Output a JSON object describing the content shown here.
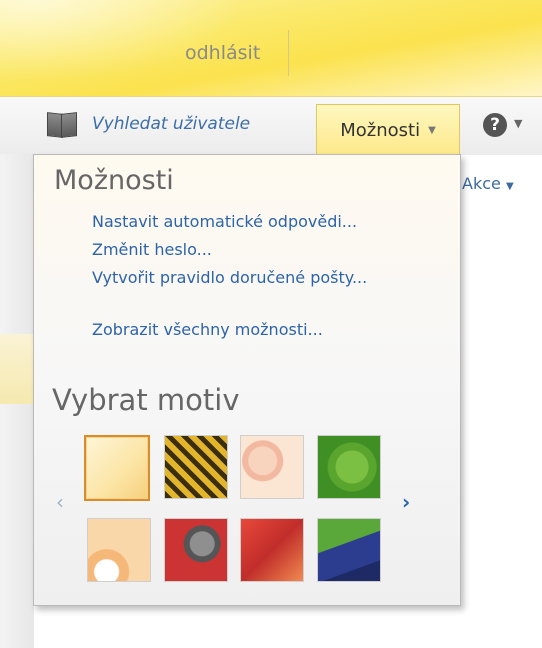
{
  "header": {
    "logout": "odhlásit"
  },
  "nav": {
    "find_user": "Vyhledat uživatele",
    "options_tab": "Možnosti",
    "help_symbol": "?",
    "actions": "Akce"
  },
  "panel": {
    "title": "Možnosti",
    "links": [
      "Nastavit automatické odpovědi...",
      "Změnit heslo...",
      "Vytvořit pravidlo doručené pošty...",
      "Zobrazit všechny možnosti..."
    ],
    "theme_title": "Vybrat motiv",
    "prev_arrow": "‹",
    "next_arrow": "›"
  },
  "icons": {
    "address_book": "address-book-icon",
    "help": "help-icon",
    "dropdown": "chevron-down-icon"
  },
  "colors": {
    "header_yellow": "#fbe24e",
    "link_blue": "#2d64a8",
    "selected_border": "#d98c2a"
  }
}
